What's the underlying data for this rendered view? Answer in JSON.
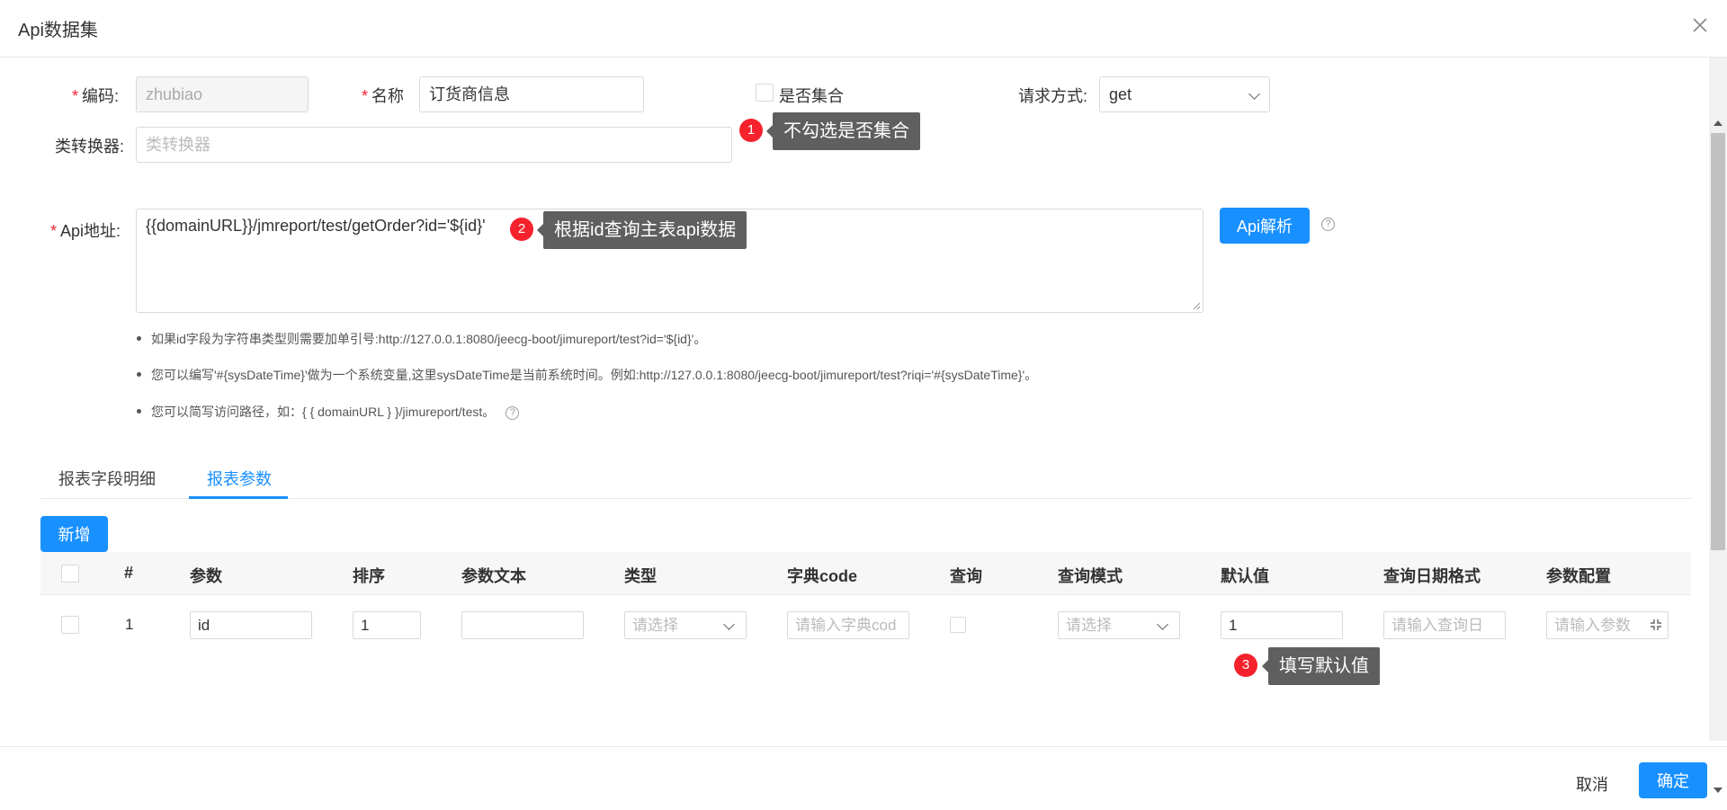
{
  "dialog": {
    "title": "Api数据集"
  },
  "form": {
    "code": {
      "label": "编码:",
      "value": "zhubiao"
    },
    "name": {
      "label": "名称",
      "value": "订货商信息"
    },
    "is_collection": {
      "label": "是否集合"
    },
    "request_method": {
      "label": "请求方式:",
      "value": "get"
    },
    "converter": {
      "label": "类转换器:",
      "placeholder": "类转换器"
    },
    "api_url": {
      "label": "Api地址:",
      "value": "{{domainURL}}/jmreport/test/getOrder?id='${id}'"
    },
    "parse_button": "Api解析"
  },
  "notes": [
    "如果id字段为字符串类型则需要加单引号:http://127.0.0.1:8080/jeecg-boot/jimureport/test?id='${id}'。",
    "您可以编写'#{sysDateTime}'做为一个系统变量,这里sysDateTime是当前系统时间。例如:http://127.0.0.1:8080/jeecg-boot/jimureport/test?riqi='#{sysDateTime}'。",
    "您可以简写访问路径，如：{ { domainURL } }/jimureport/test。"
  ],
  "tooltips": {
    "t1": {
      "num": "1",
      "text": "不勾选是否集合"
    },
    "t2": {
      "num": "2",
      "text": "根据id查询主表api数据"
    },
    "t3": {
      "num": "3",
      "text": "填写默认值"
    }
  },
  "tabs": [
    "报表字段明细",
    "报表参数"
  ],
  "add_button": "新增",
  "table": {
    "headers": [
      "#",
      "参数",
      "排序",
      "参数文本",
      "类型",
      "字典code",
      "查询",
      "查询模式",
      "默认值",
      "查询日期格式",
      "参数配置"
    ],
    "row": {
      "index": "1",
      "param": "id",
      "order": "1",
      "param_text": "",
      "type_placeholder": "请选择",
      "dict_placeholder": "请输入字典cod",
      "mode_placeholder": "请选择",
      "default_value": "1",
      "date_format_placeholder": "请输入查询日",
      "config_placeholder": "请输入参数"
    }
  },
  "footer": {
    "cancel": "取消",
    "confirm": "确定"
  },
  "colors": {
    "primary": "#1890ff",
    "required": "#f5222d",
    "tooltip_bg": "#5f5f5f"
  }
}
